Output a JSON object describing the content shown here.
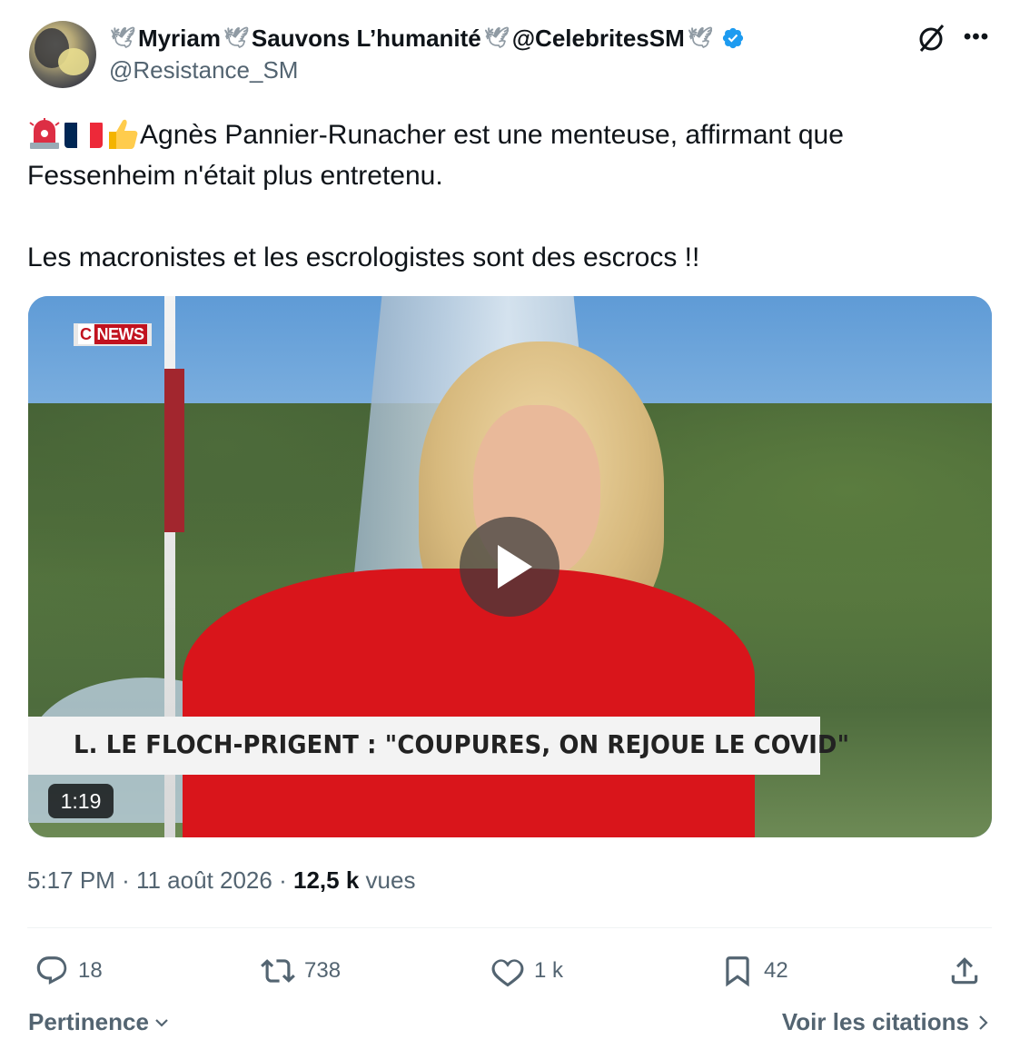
{
  "author": {
    "display_name_parts": [
      "Myriam",
      "Sauvons L’humanité",
      "@CelebritesSM"
    ],
    "handle": "@Resistance_SM",
    "verified": true
  },
  "tweet": {
    "line1": "Agnès Pannier-Runacher est une menteuse, affirmant que",
    "line2": "Fessenheim n'était plus entretenu.",
    "line3": "Les macronistes et les escrologistes sont des escrocs !!"
  },
  "video": {
    "channel_c": "C",
    "channel_name": "NEWS",
    "caption": "L. LE FLOCH-PRIGENT : \"COUPURES, ON REJOUE LE COVID\"",
    "duration": "1:19"
  },
  "meta": {
    "time": "5:17 PM",
    "sep": "·",
    "date": "11 août 2026",
    "views_count": "12,5 k",
    "views_label": "vues"
  },
  "actions": {
    "replies": "18",
    "reposts": "738",
    "likes": "1 k",
    "bookmarks": "42"
  },
  "footer": {
    "sort_label": "Pertinence",
    "quotes_label": "Voir les citations"
  },
  "colors": {
    "verified_blue": "#1d9bf0",
    "secondary_text": "#536471",
    "primary_text": "#0f1419"
  }
}
